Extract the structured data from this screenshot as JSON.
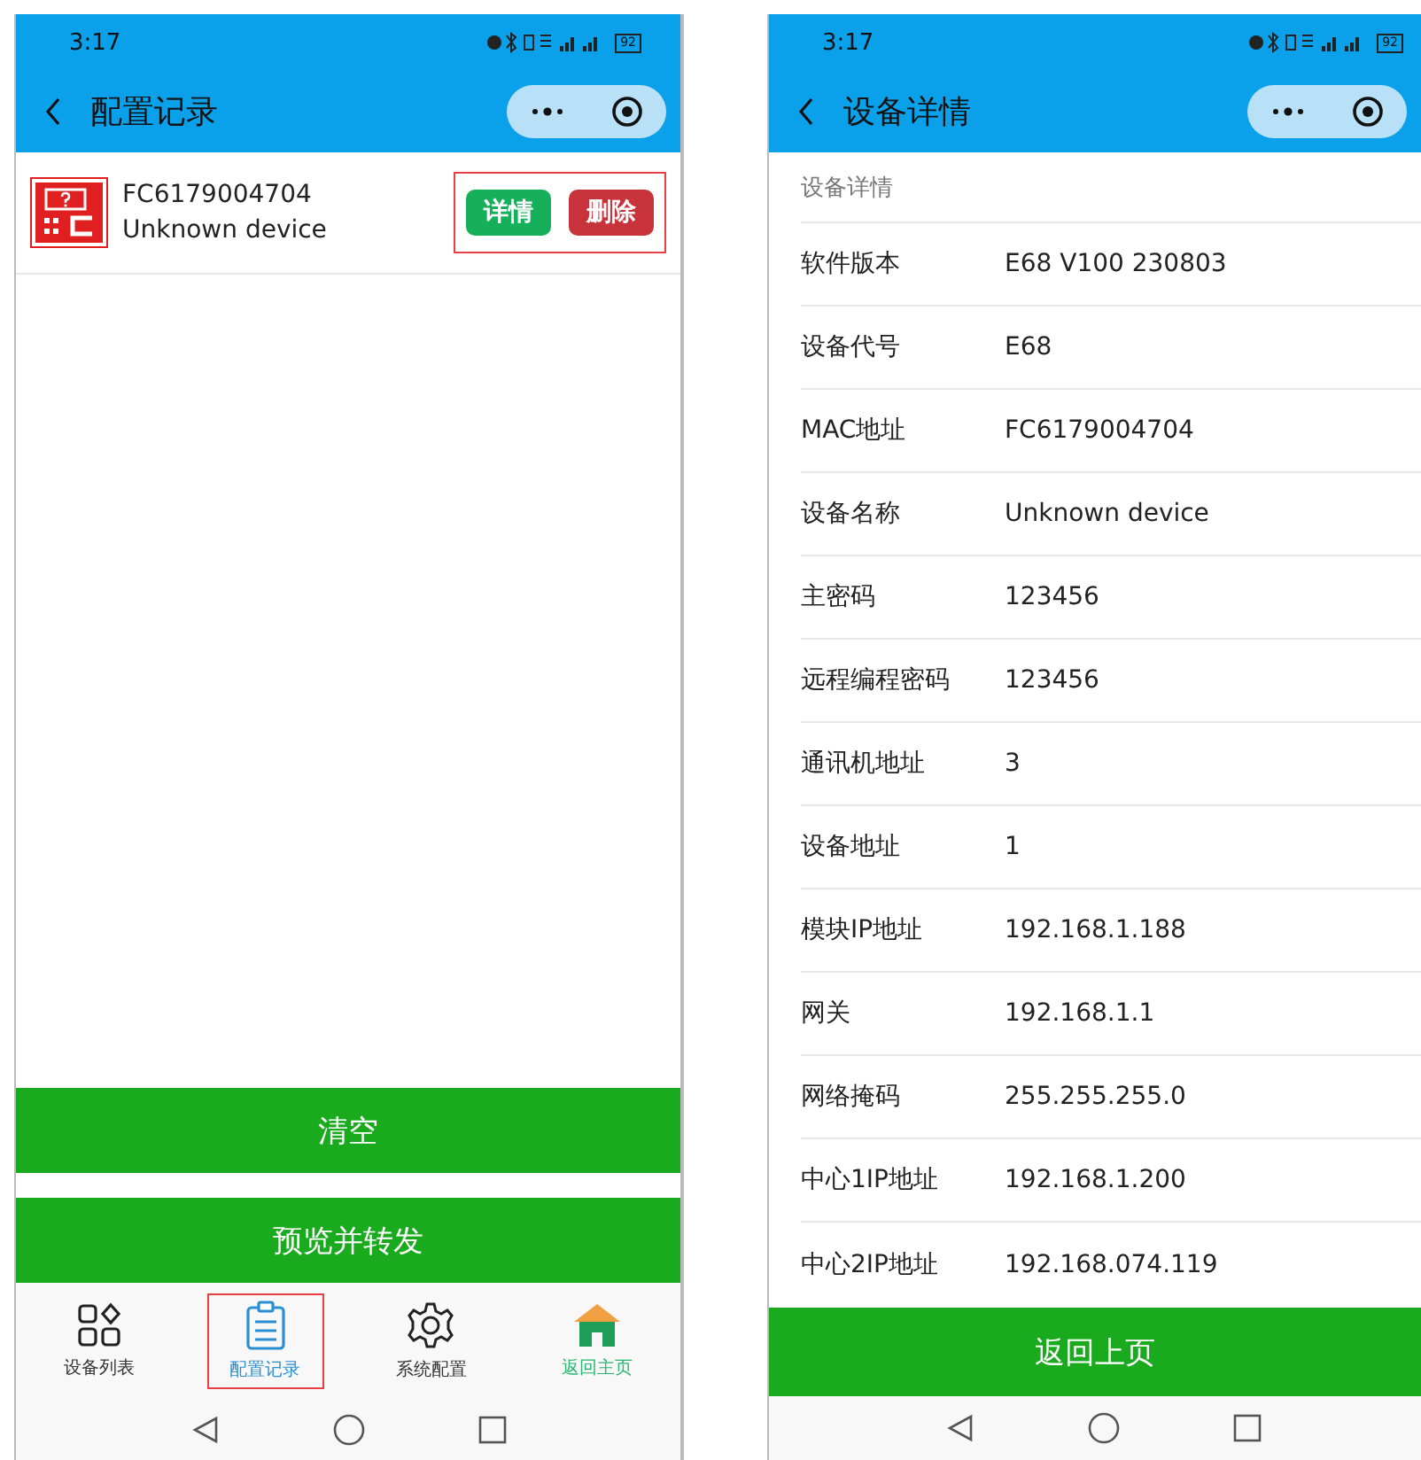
{
  "left_screen": {
    "status_bar": {
      "time": "3:17",
      "battery": "92"
    },
    "header": {
      "title": "配置记录"
    },
    "records": [
      {
        "mac": "FC6179004704",
        "name": "Unknown device",
        "actions": [
          "详情",
          "删除"
        ],
        "highlighted": true
      }
    ],
    "buttons": [
      "清空",
      "预览并转发"
    ],
    "tab_bar": [
      {
        "label": "设备列表",
        "kind": "devices",
        "selected": false
      },
      {
        "label": "配置记录",
        "kind": "records",
        "selected": true
      },
      {
        "label": "系统配置",
        "kind": "settings",
        "selected": false
      },
      {
        "label": "返回主页",
        "kind": "home",
        "selected": false
      }
    ]
  },
  "right_screen": {
    "status_bar": {
      "time": "3:17",
      "battery": "92"
    },
    "header": {
      "title": "设备详情"
    },
    "section_title": "设备详情",
    "rows": [
      {
        "label": "软件版本",
        "value": "E68 V100 230803"
      },
      {
        "label": "设备代号",
        "value": "E68"
      },
      {
        "label": "MAC地址",
        "value": "FC6179004704"
      },
      {
        "label": "设备名称",
        "value": "Unknown device"
      },
      {
        "label": "主密码",
        "value": "123456"
      },
      {
        "label": "远程编程密码",
        "value": "123456"
      },
      {
        "label": "通讯机地址",
        "value": "3"
      },
      {
        "label": "设备地址",
        "value": "1"
      },
      {
        "label": "模块IP地址",
        "value": "192.168.1.188"
      },
      {
        "label": "网关",
        "value": "192.168.1.1"
      },
      {
        "label": "网络掩码",
        "value": "255.255.255.0"
      },
      {
        "label": "中心1IP地址",
        "value": "192.168.1.200"
      },
      {
        "label": "中心2IP地址",
        "value": "192.168.074.119"
      }
    ],
    "button": "返回上页"
  }
}
